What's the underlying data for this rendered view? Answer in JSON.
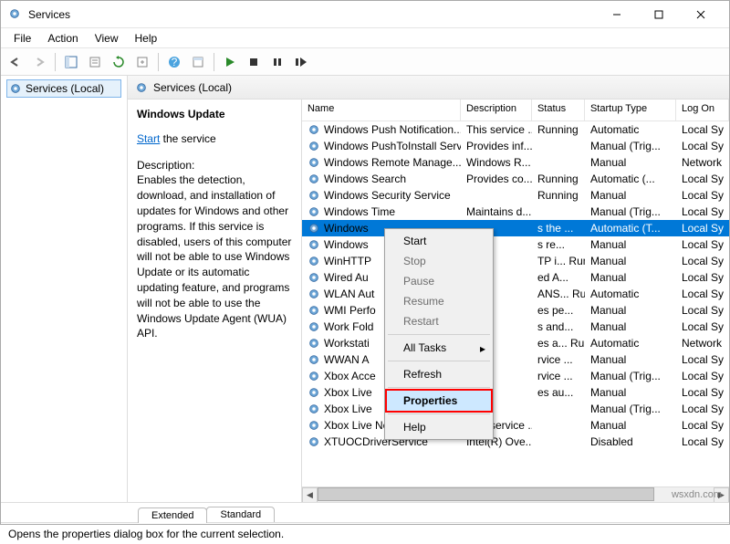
{
  "window": {
    "title": "Services"
  },
  "menus": {
    "file": "File",
    "action": "Action",
    "view": "View",
    "help": "Help"
  },
  "left_tree": {
    "node": "Services (Local)"
  },
  "detail_header": "Services (Local)",
  "info_pane": {
    "heading": "Windows Update",
    "start_link": "Start",
    "start_rest": " the service",
    "desc_label": "Description:",
    "desc_text": "Enables the detection, download, and installation of updates for Windows and other programs. If this service is disabled, users of this computer will not be able to use Windows Update or its automatic updating feature, and programs will not be able to use the Windows Update Agent (WUA) API."
  },
  "columns": {
    "name": "Name",
    "desc": "Description",
    "status": "Status",
    "startup": "Startup Type",
    "logon": "Log On"
  },
  "services": [
    {
      "name": "Windows Push Notification...",
      "desc": "This service ...",
      "status": "Running",
      "type": "Automatic",
      "log": "Local Sy"
    },
    {
      "name": "Windows PushToInstall Serv...",
      "desc": "Provides inf...",
      "status": "",
      "type": "Manual (Trig...",
      "log": "Local Sy"
    },
    {
      "name": "Windows Remote Manage...",
      "desc": "Windows R...",
      "status": "",
      "type": "Manual",
      "log": "Network"
    },
    {
      "name": "Windows Search",
      "desc": "Provides co...",
      "status": "Running",
      "type": "Automatic (...",
      "log": "Local Sy"
    },
    {
      "name": "Windows Security Service",
      "desc": "",
      "status": "Running",
      "type": "Manual",
      "log": "Local Sy"
    },
    {
      "name": "Windows Time",
      "desc": "Maintains d...",
      "status": "",
      "type": "Manual (Trig...",
      "log": "Local Sy"
    },
    {
      "name": "Windows",
      "desc": "",
      "status": "s the ...",
      "type": "Automatic (T...",
      "log": "Local Sy",
      "selected": true
    },
    {
      "name": "Windows",
      "desc": "",
      "status": "s re...",
      "type": "Manual",
      "log": "Local Sy"
    },
    {
      "name": "WinHTTP",
      "desc": "",
      "status": "TP i...   Running",
      "type": "Manual",
      "log": "Local Sy"
    },
    {
      "name": "Wired Au",
      "desc": "",
      "status": "ed A...",
      "type": "Manual",
      "log": "Local Sy"
    },
    {
      "name": "WLAN Aut",
      "desc": "",
      "status": "ANS...  Running",
      "type": "Automatic",
      "log": "Local Sy"
    },
    {
      "name": "WMI Perfo",
      "desc": "",
      "status": "es pe...",
      "type": "Manual",
      "log": "Local Sy"
    },
    {
      "name": "Work Fold",
      "desc": "",
      "status": "s and...",
      "type": "Manual",
      "log": "Local Sy"
    },
    {
      "name": "Workstati",
      "desc": "",
      "status": "es a...   Running",
      "type": "Automatic",
      "log": "Network"
    },
    {
      "name": "WWAN A",
      "desc": "",
      "status": "rvice ...",
      "type": "Manual",
      "log": "Local Sy"
    },
    {
      "name": "Xbox Acce",
      "desc": "",
      "status": "rvice ...",
      "type": "Manual (Trig...",
      "log": "Local Sy"
    },
    {
      "name": "Xbox Live",
      "desc": "",
      "status": "es au...",
      "type": "Manual",
      "log": "Local Sy"
    },
    {
      "name": "Xbox Live",
      "desc": "",
      "status": "",
      "type": "Manual (Trig...",
      "log": "Local Sy"
    },
    {
      "name": "Xbox Live Networking Service",
      "desc": "This service ...",
      "status": "",
      "type": "Manual",
      "log": "Local Sy"
    },
    {
      "name": "XTUOCDriverService",
      "desc": "Intel(R) Ove...",
      "status": "",
      "type": "Disabled",
      "log": "Local Sy"
    }
  ],
  "context_menu": {
    "start": "Start",
    "stop": "Stop",
    "pause": "Pause",
    "resume": "Resume",
    "restart": "Restart",
    "all_tasks": "All Tasks",
    "refresh": "Refresh",
    "properties": "Properties",
    "help": "Help"
  },
  "tabs": {
    "extended": "Extended",
    "standard": "Standard"
  },
  "statusbar": "Opens the properties dialog box for the current selection.",
  "watermark": "wsxdn.com"
}
